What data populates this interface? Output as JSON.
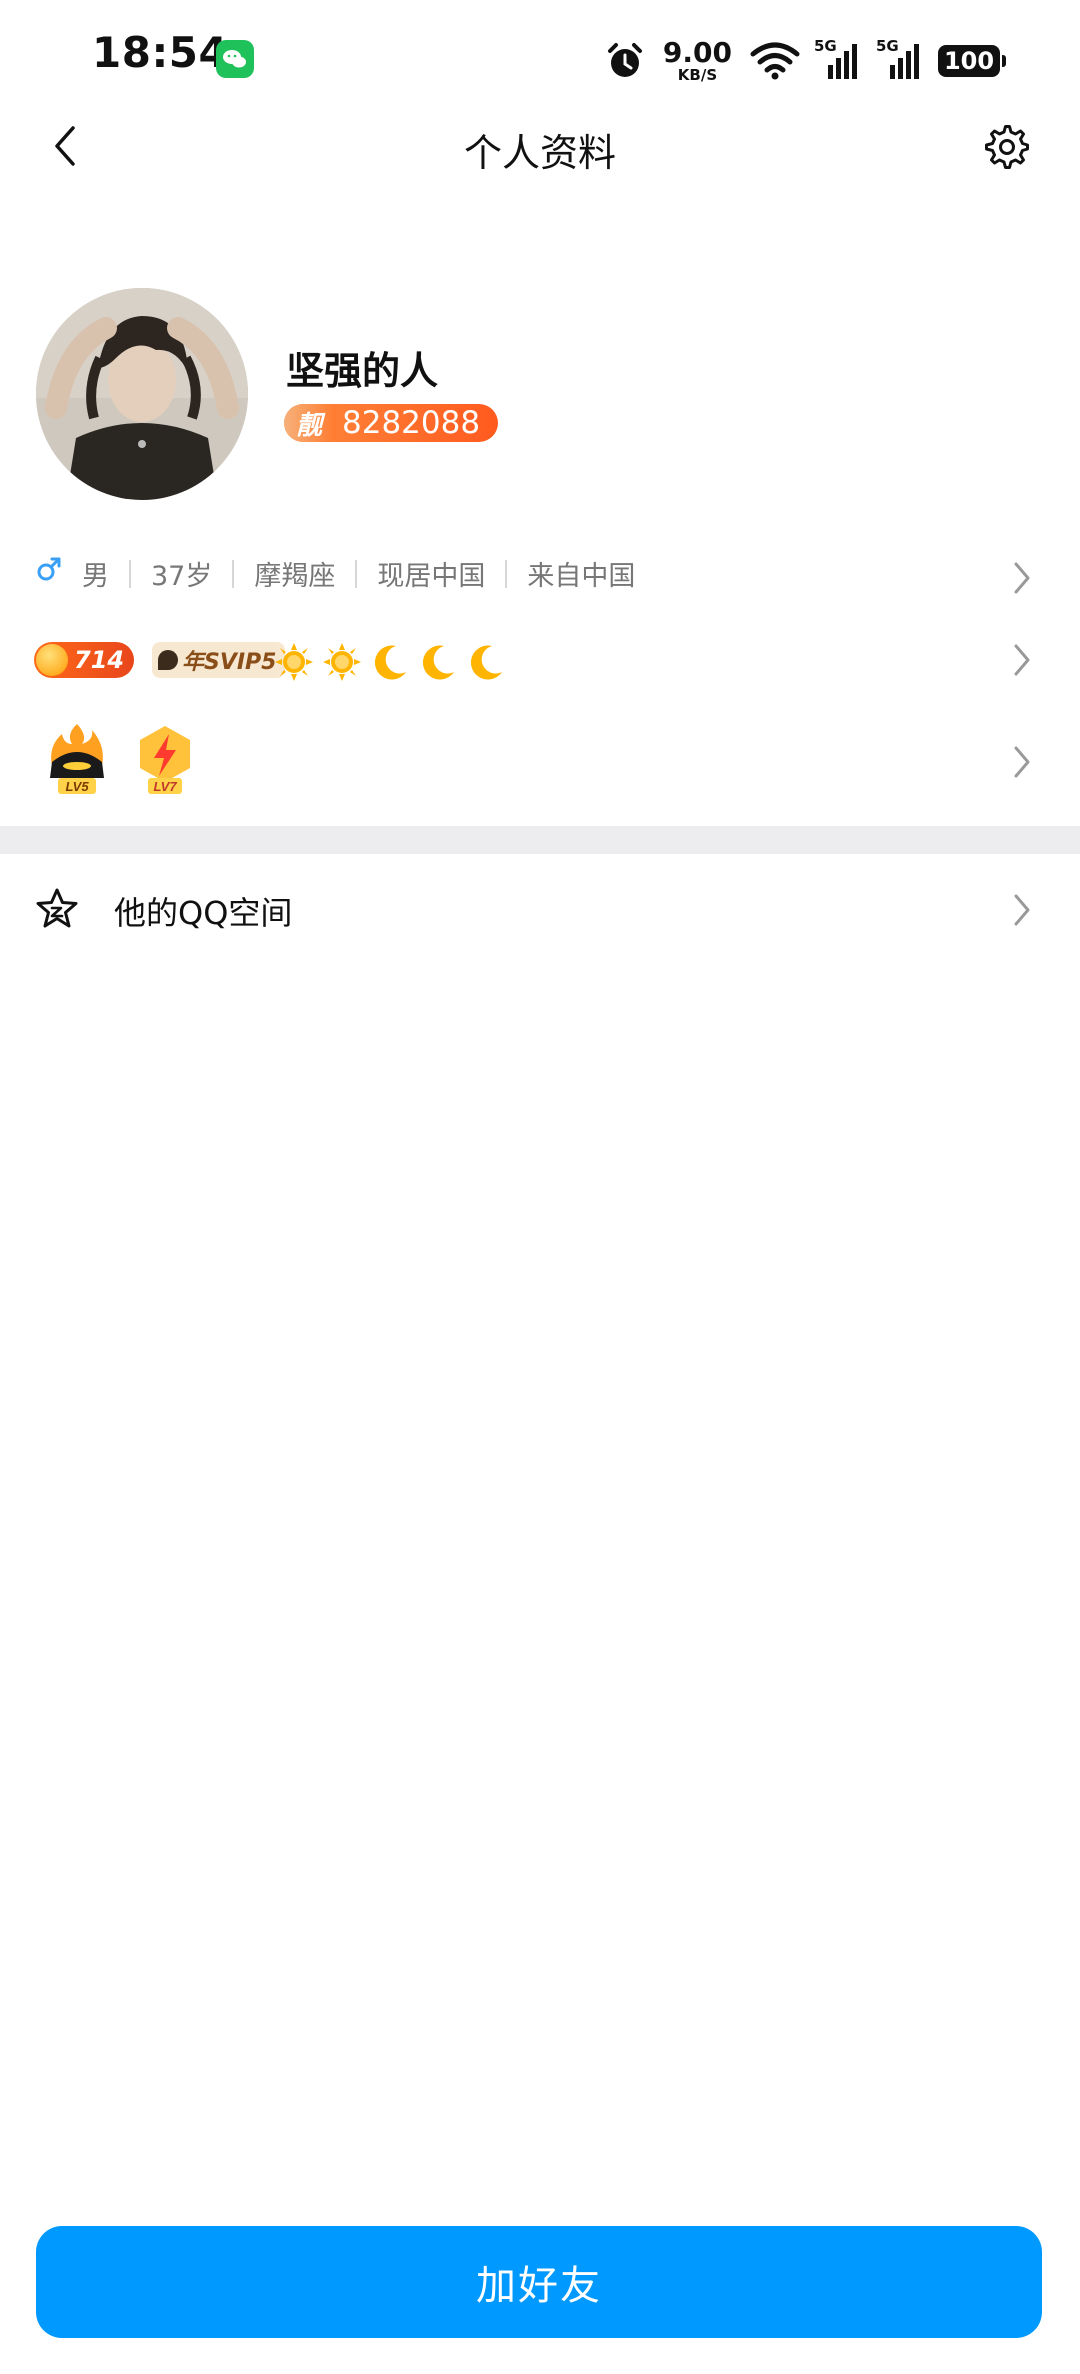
{
  "status_bar": {
    "time": "18:54",
    "net_speed_value": "9.00",
    "net_speed_unit": "KB/S",
    "signal_1_label": "5G",
    "signal_2_label": "5G",
    "battery": "100"
  },
  "nav": {
    "title": "个人资料"
  },
  "profile": {
    "nickname": "坚强的人",
    "qq_badge_tag": "靓",
    "qq_number": "8282088",
    "info": [
      "男",
      "37岁",
      "摩羯座",
      "现居中国",
      "来自中国"
    ]
  },
  "vip": {
    "active_days": "714",
    "svip_label": "年SVIP5",
    "level_icons": [
      "sun-icon",
      "sun-icon",
      "moon-icon",
      "moon-icon",
      "moon-icon"
    ]
  },
  "medals": [
    {
      "name": "flame-helmet-medal",
      "label": "LV5"
    },
    {
      "name": "lightning-medal",
      "label": "LV7"
    }
  ],
  "qzone": {
    "label": "他的QQ空间"
  },
  "actions": {
    "add_friend": "加好友"
  },
  "colors": {
    "primary_button": "#0099ff",
    "badge_orange": "#ff5a1f",
    "divider": "#ededf0"
  }
}
